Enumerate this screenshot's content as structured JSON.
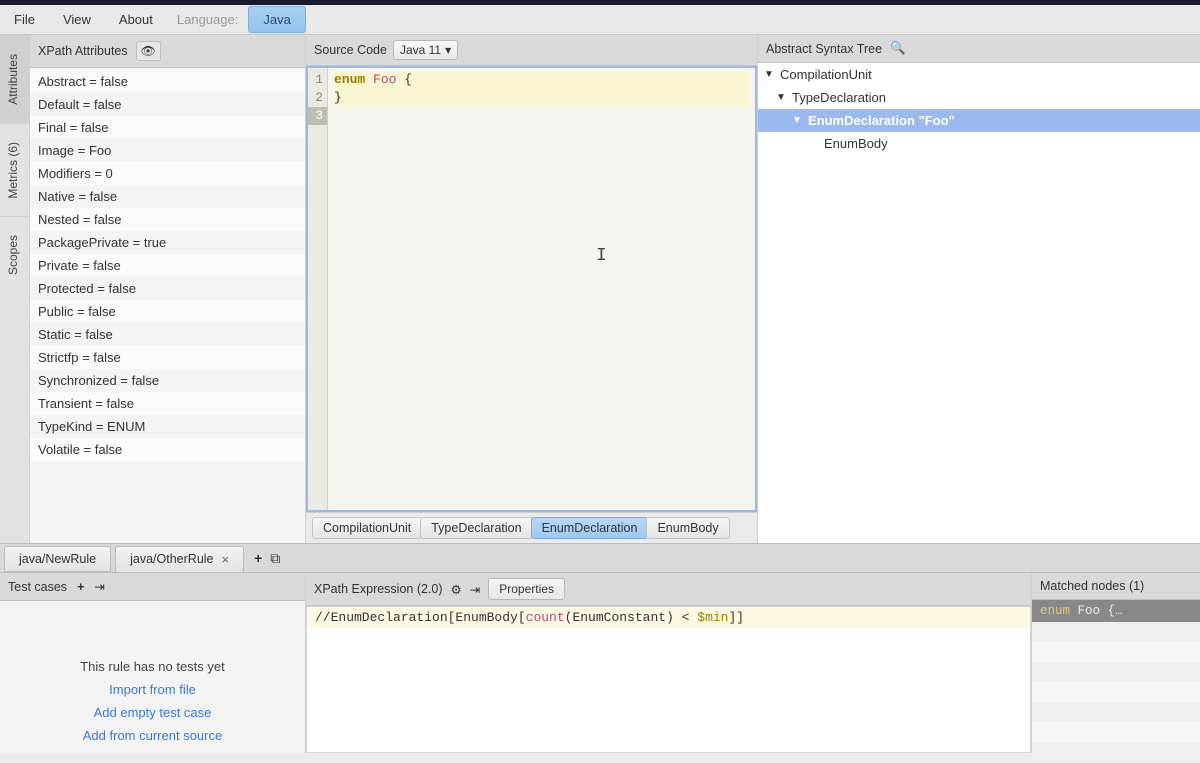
{
  "menu": {
    "file": "File",
    "view": "View",
    "about": "About",
    "language_label": "Language:",
    "language_value": "Java"
  },
  "side_tabs": [
    "Attributes",
    "Metrics    (6)",
    "Scopes"
  ],
  "attributes_panel": {
    "title": "XPath Attributes",
    "rows": [
      "Abstract = false",
      "Default = false",
      "Final = false",
      "Image = Foo",
      "Modifiers = 0",
      "Native = false",
      "Nested = false",
      "PackagePrivate = true",
      "Private = false",
      "Protected = false",
      "Public = false",
      "Static = false",
      "Strictfp = false",
      "Synchronized = false",
      "Transient = false",
      "TypeKind = ENUM",
      "Volatile = false"
    ]
  },
  "source_panel": {
    "title": "Source Code",
    "version": "Java 11",
    "lines": {
      "l1a": "enum",
      "l1b": " Foo",
      "l1c": " {",
      "l2": "",
      "l3": "}"
    },
    "gutter": [
      "1",
      "2",
      "3"
    ],
    "breadcrumb": [
      "CompilationUnit",
      "TypeDeclaration",
      "EnumDeclaration",
      "EnumBody"
    ]
  },
  "ast_panel": {
    "title": "Abstract Syntax Tree",
    "nodes": {
      "n0": "CompilationUnit",
      "n1": "TypeDeclaration",
      "n2": "EnumDeclaration \"Foo\"",
      "n3": "EnumBody"
    }
  },
  "rules_bar": {
    "tabs": [
      "java/NewRule",
      "java/OtherRule"
    ]
  },
  "tests_panel": {
    "title": "Test cases",
    "message": "This rule has no tests yet",
    "links": [
      "Import from file",
      "Add empty test case",
      "Add from current source"
    ]
  },
  "xpath_panel": {
    "title": "XPath Expression (2.0)",
    "properties_btn": "Properties",
    "expr_pre": "//EnumDeclaration[EnumBody[",
    "expr_fn": "count",
    "expr_mid": "(EnumConstant) < ",
    "expr_var": "$min",
    "expr_post": "]]"
  },
  "matched_panel": {
    "title": "Matched nodes (1)",
    "row_kw": "enum",
    "row_rest": " Foo {…"
  }
}
